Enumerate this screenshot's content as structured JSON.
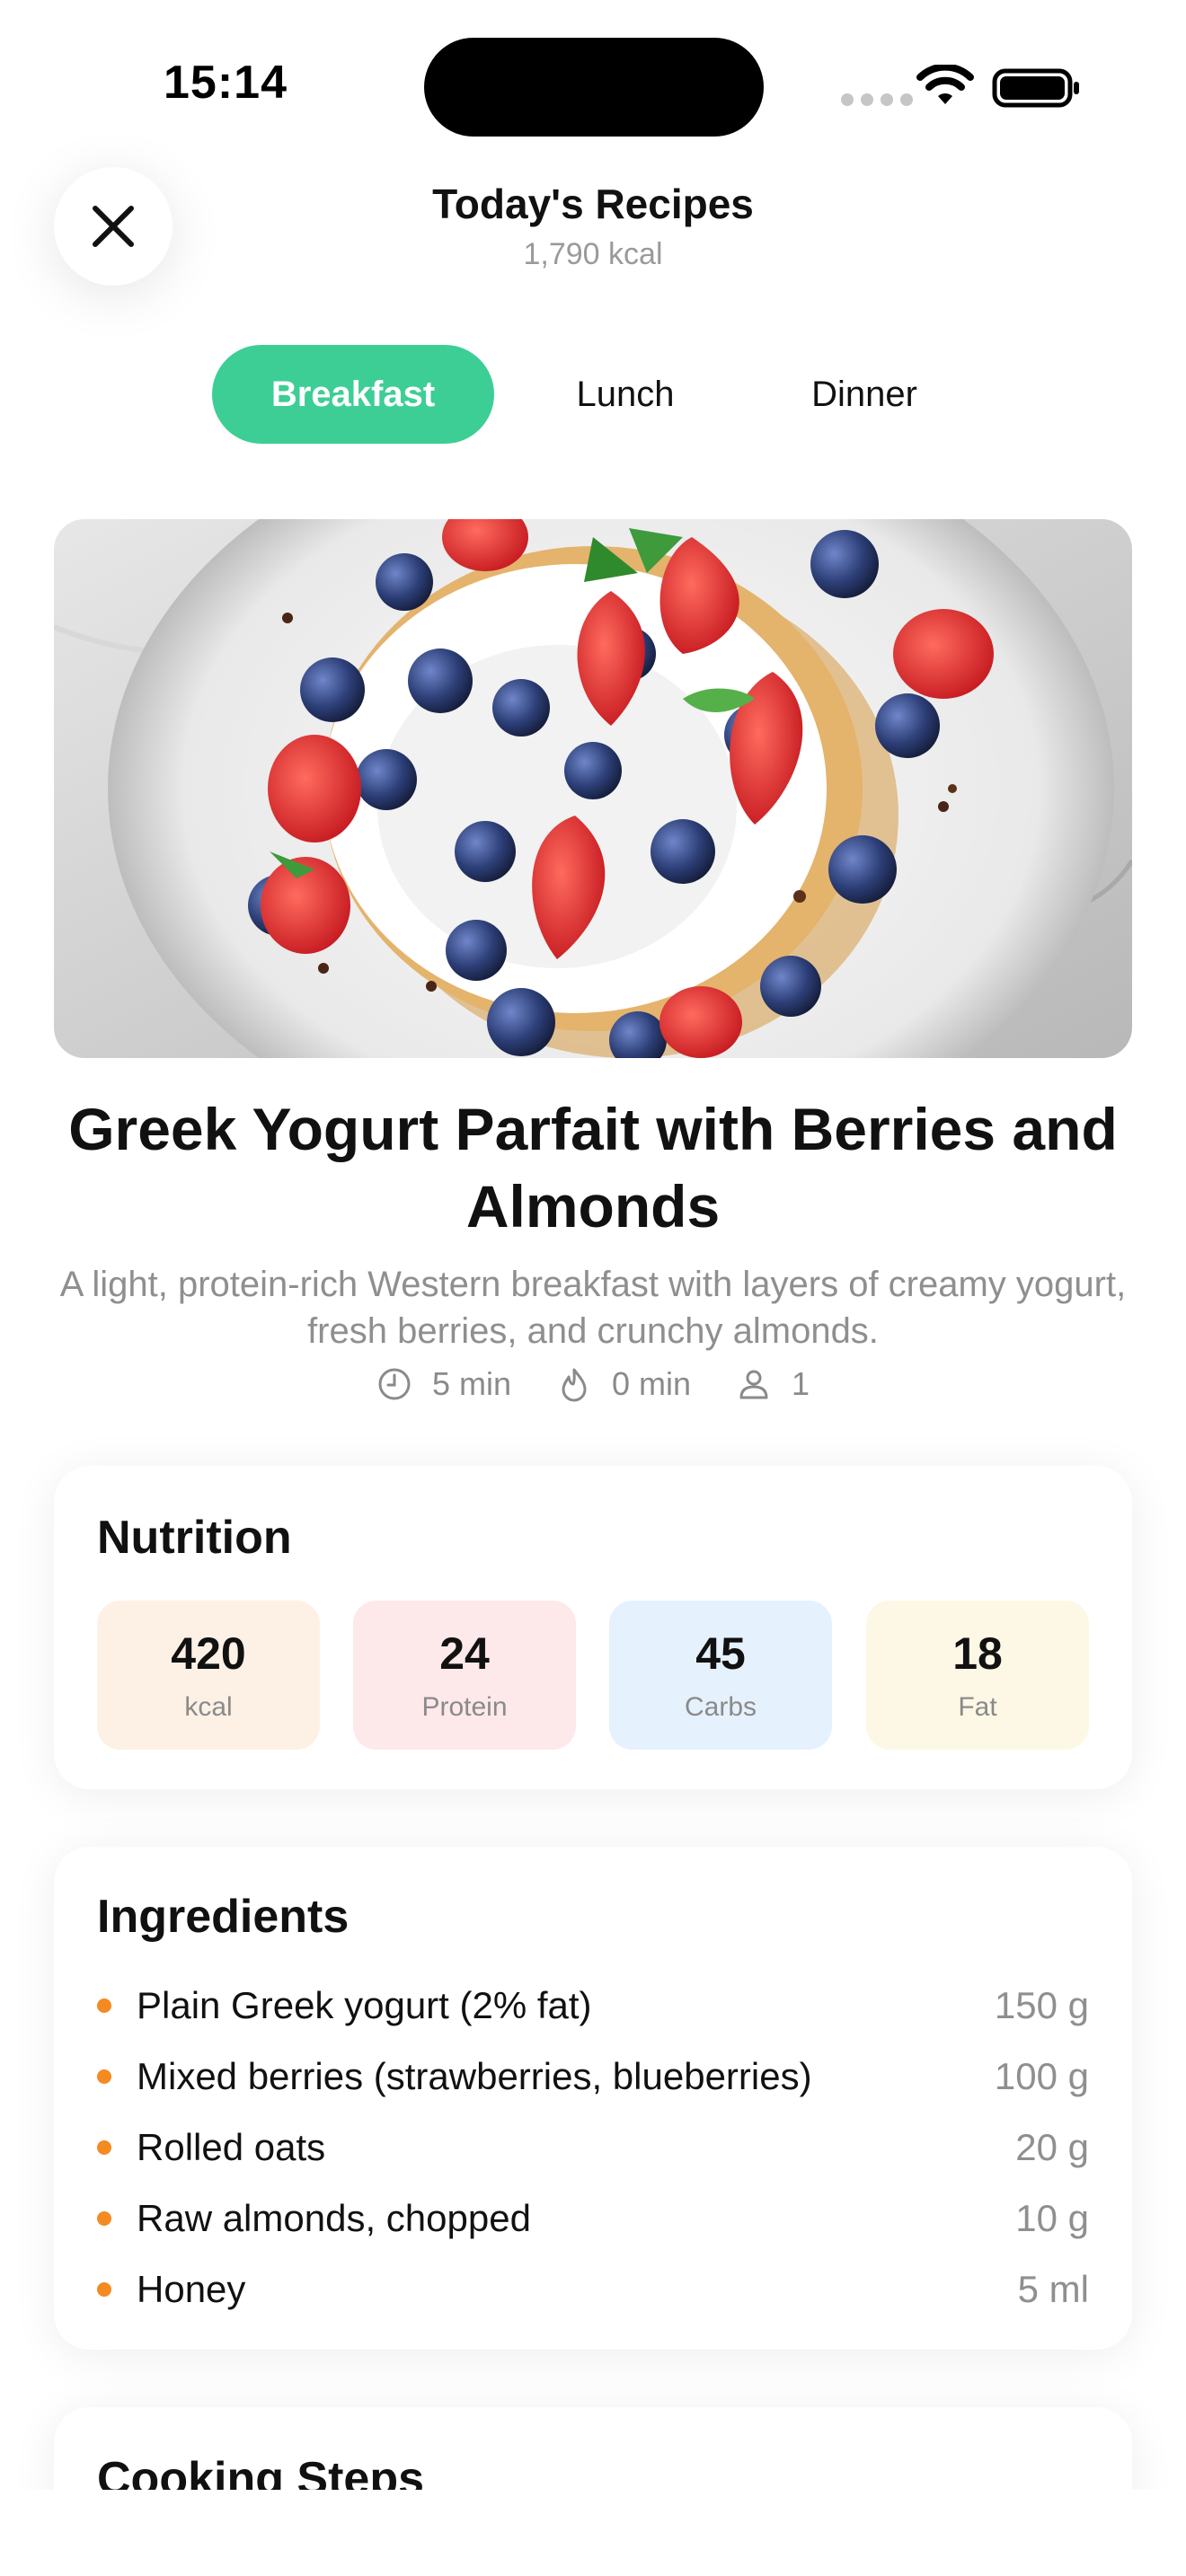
{
  "status_bar": {
    "time": "15:14"
  },
  "header": {
    "title": "Today's Recipes",
    "subtitle": "1,790 kcal",
    "close_icon": "close-icon"
  },
  "tabs": [
    {
      "label": "Breakfast",
      "active": true
    },
    {
      "label": "Lunch",
      "active": false
    },
    {
      "label": "Dinner",
      "active": false
    }
  ],
  "colors": {
    "accent": "#3dce95",
    "bullet": "#f48a22",
    "kcal_bg": "#fdf1e6",
    "protein_bg": "#fde8ea",
    "carbs_bg": "#e5f1fd",
    "fat_bg": "#fdf8e5"
  },
  "recipe": {
    "image": "greek-yogurt-parfait-photo",
    "title": "Greek Yogurt Parfait with Berries and Almonds",
    "description": "A light, protein-rich Western breakfast with layers of creamy yogurt, fresh berries, and crunchy almonds.",
    "prep_time": "5 min",
    "cook_time": "0 min",
    "servings": "1"
  },
  "nutrition": {
    "title": "Nutrition",
    "items": [
      {
        "value": "420",
        "label": "kcal"
      },
      {
        "value": "24",
        "label": "Protein"
      },
      {
        "value": "45",
        "label": "Carbs"
      },
      {
        "value": "18",
        "label": "Fat"
      }
    ]
  },
  "ingredients": {
    "title": "Ingredients",
    "items": [
      {
        "name": "Plain Greek yogurt (2% fat)",
        "amount": "150 g"
      },
      {
        "name": "Mixed berries (strawberries, blueberries)",
        "amount": "100 g"
      },
      {
        "name": "Rolled oats",
        "amount": "20 g"
      },
      {
        "name": "Raw almonds, chopped",
        "amount": "10 g"
      },
      {
        "name": "Honey",
        "amount": "5 ml"
      }
    ]
  },
  "cooking_steps": {
    "title": "Cooking Steps"
  }
}
